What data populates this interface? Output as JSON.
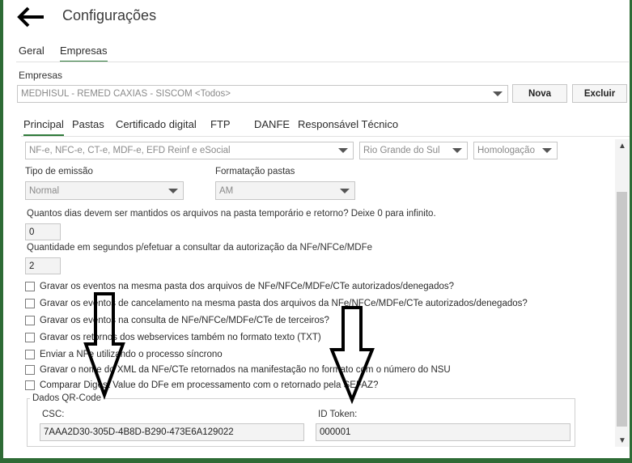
{
  "header": {
    "title": "Configurações",
    "back_icon": "arrow-left-icon"
  },
  "main_tabs": [
    {
      "label": "Geral",
      "active": false
    },
    {
      "label": "Empresas",
      "active": true
    }
  ],
  "empresas": {
    "label": "Empresas",
    "selected": "MEDHISUL - REMED CAXIAS - SISCOM  <Todos>",
    "nova_label": "Nova",
    "excluir_label": "Excluir"
  },
  "sub_tabs": [
    {
      "label": "Principal",
      "active": true
    },
    {
      "label": "Pastas",
      "active": false
    },
    {
      "label": "Certificado digital",
      "active": false
    },
    {
      "label": "FTP",
      "active": false
    },
    {
      "label": "DANFE",
      "active": false
    },
    {
      "label": "Responsável Técnico",
      "active": false
    }
  ],
  "principal": {
    "documentos_select": "NF-e, NFC-e, CT-e, MDF-e, EFD Reinf e eSocial",
    "uf_select": "Rio Grande do Sul",
    "ambiente_select": "Homologação",
    "tipo_emissao_label": "Tipo de emissão",
    "tipo_emissao_value": "Normal",
    "formatacao_label": "Formatação pastas",
    "formatacao_value": "AM",
    "dias_label": "Quantos dias devem ser mantidos os arquivos na pasta temporário e retorno? Deixe 0 para infinito.",
    "dias_value": "0",
    "segundos_label": "Quantidade em segundos p/efetuar a consultar da autorização da NFe/NFCe/MDFe",
    "segundos_value": "2",
    "checkboxes": [
      "Gravar os eventos na mesma pasta dos arquivos de NFe/NFCe/MDFe/CTe autorizados/denegados?",
      "Gravar os eventos de cancelamento na mesma pasta dos arquivos da NFe/NFCe/MDFe/CTe autorizados/denegados?",
      "Gravar os eventos na consulta de NFe/NFCe/MDFe/CTe de terceiros?",
      "Gravar os retornos dos webservices também no formato texto (TXT)",
      "Enviar a NFe utilizando o processo síncrono",
      "Gravar o nome do XML da NFe/CTe retornados na manifestação no formato com o número do NSU",
      "Comparar Digest Value do DFe em processamento com o retornado pela SEFAZ?"
    ]
  },
  "qrcode": {
    "legend": "Dados QR-Code",
    "csc_label": "CSC:",
    "csc_value": "7AAA2D30-305D-4B8D-B290-473E6A129022",
    "id_token_label": "ID Token:",
    "id_token_value": "000001"
  },
  "colors": {
    "accent": "#2f7a3a",
    "frame": "#2e6b35"
  }
}
